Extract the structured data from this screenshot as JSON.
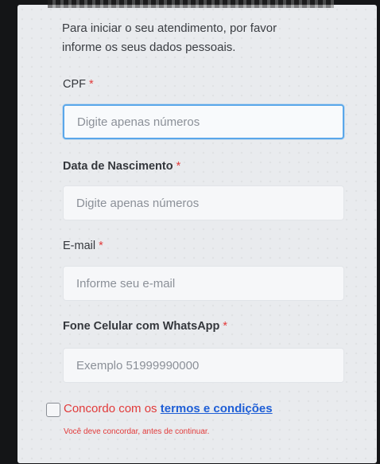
{
  "form": {
    "intro_line1": "Para iniciar o seu atendimento, por favor",
    "intro_line2": "informe os seus dados pessoais.",
    "required_marker": "*",
    "cpf": {
      "label": "CPF",
      "placeholder": "Digite apenas números",
      "value": ""
    },
    "birthdate": {
      "label": "Data de Nascimento",
      "placeholder": "Digite apenas números",
      "value": ""
    },
    "email": {
      "label": "E-mail",
      "placeholder": "Informe seu e-mail",
      "value": ""
    },
    "phone": {
      "label": "Fone Celular com WhatsApp",
      "placeholder": "Exemplo 51999990000",
      "value": ""
    },
    "terms": {
      "checked": false,
      "text": "Concordo com os",
      "link_text": "termos e condições",
      "error": "Você deve concordar, antes de continuar."
    }
  },
  "colors": {
    "required": "#e23a3a",
    "link": "#1f5fd6",
    "focus_border": "#5aa7ea",
    "panel_bg": "#e9ebee"
  }
}
